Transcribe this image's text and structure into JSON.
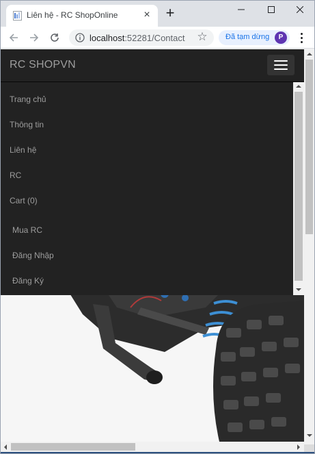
{
  "browser": {
    "tab_title": "Liên hệ - RC ShopOnline",
    "tab_close": "×",
    "new_tab": "+",
    "url_host": "localhost",
    "url_path": ":52281/Contact",
    "star": "☆",
    "paused_label": "Đã tạm dừng",
    "profile_initial": "P"
  },
  "navbar": {
    "brand": "RC SHOPVN",
    "menu": [
      "Trang chủ",
      "Thông tin",
      "Liên hệ",
      "RC",
      "Cart (0)",
      "Mua RC",
      "Đăng Nhập",
      "Đăng Ký"
    ]
  },
  "colors": {
    "navbar_bg": "#222222",
    "nav_link": "#9d9d9d",
    "accent": "#1a73e8"
  }
}
